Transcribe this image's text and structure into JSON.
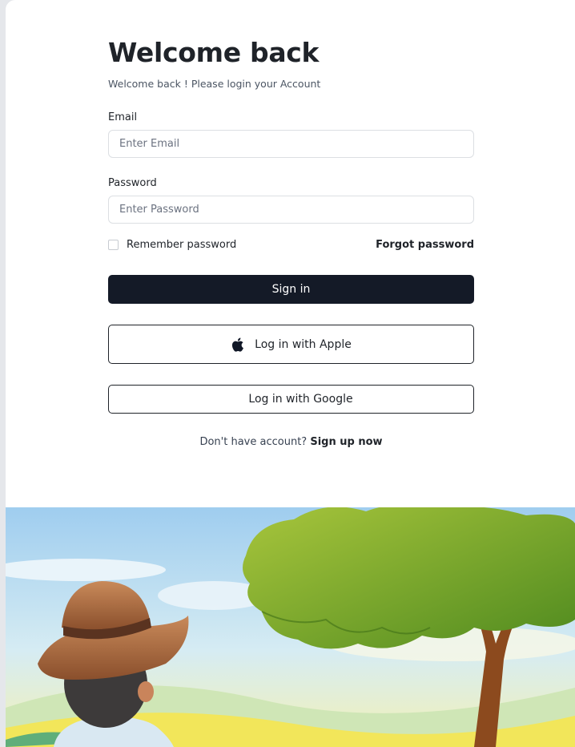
{
  "login": {
    "title": "Welcome back",
    "subtitle": "Welcome back ! Please login your Account",
    "email_label": "Email",
    "email_placeholder": "Enter Email",
    "password_label": "Password",
    "password_placeholder": "Enter Password",
    "remember_label": "Remember password",
    "forgot_label": "Forgot password",
    "signin_label": "Sign in",
    "apple_label": "Log in with Apple",
    "google_label": "Log in with Google",
    "signup_prompt": "Don't have account?",
    "signup_link": "Sign up now"
  },
  "colors": {
    "primary_button": "#141a27",
    "text": "#1f2329",
    "border": "#dcdfe3"
  },
  "icons": {
    "apple": "apple-icon",
    "checkbox": "checkbox-icon"
  }
}
